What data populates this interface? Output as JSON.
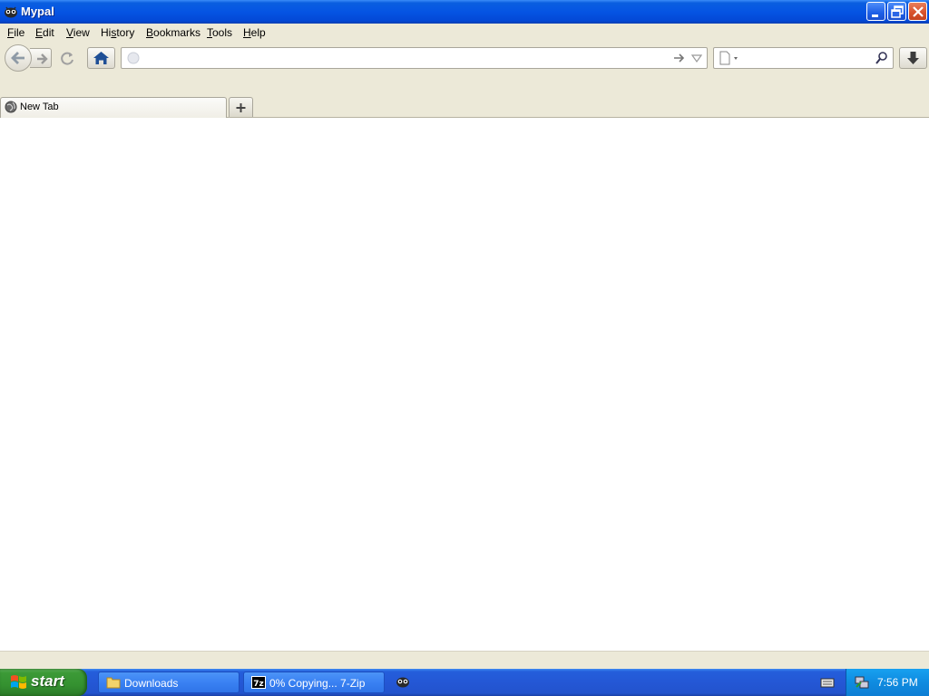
{
  "window": {
    "title": "Mypal",
    "controls": [
      "minimize",
      "restore",
      "close"
    ]
  },
  "menu": {
    "items": [
      {
        "label": "File",
        "accel": "F"
      },
      {
        "label": "Edit",
        "accel": "E"
      },
      {
        "label": "View",
        "accel": "V"
      },
      {
        "label": "History",
        "accel": "s"
      },
      {
        "label": "Bookmarks",
        "accel": "B"
      },
      {
        "label": "Tools",
        "accel": "T"
      },
      {
        "label": "Help",
        "accel": "H"
      }
    ]
  },
  "toolbar": {
    "url_value": "",
    "search_value": ""
  },
  "tabs": [
    {
      "label": "New Tab",
      "active": true
    }
  ],
  "taskbar": {
    "start_label": "start",
    "buttons": [
      {
        "label": "Downloads",
        "icon": "folder-icon"
      },
      {
        "label": "0% Copying... 7-Zip",
        "icon": "7zip-icon"
      },
      {
        "label": "",
        "icon": "mypal-icon"
      }
    ],
    "clock": "7:56 PM"
  },
  "colors": {
    "titlebar": "#0554e3",
    "taskbar": "#2457d5",
    "start": "#349130",
    "tray": "#0f8be0",
    "chrome": "#ece9d8"
  }
}
